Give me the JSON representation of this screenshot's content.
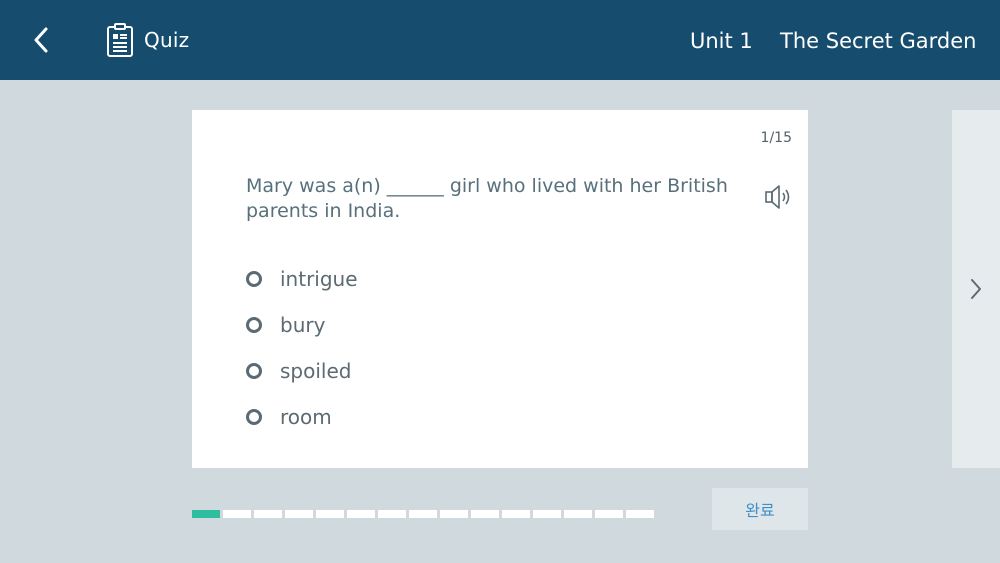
{
  "header": {
    "quiz_label": "Quiz",
    "unit": "Unit 1",
    "book_title": "The Secret Garden",
    "icons": {
      "back": "chevron-left-icon",
      "quiz": "clipboard-icon"
    }
  },
  "question": {
    "counter": "1/15",
    "text": "Mary was a(n) ______ girl who lived with her British parents in India.",
    "audio_icon": "speaker-icon",
    "options": [
      "intrigue",
      "bury",
      "spoiled",
      "room"
    ]
  },
  "progress": {
    "total": 15,
    "current": 1
  },
  "footer": {
    "done_label": "완료"
  },
  "colors": {
    "header_bg": "#164d6e",
    "page_bg": "#d0d9dd",
    "progress_active": "#2ebd9e",
    "done_text": "#3e8fc9"
  }
}
